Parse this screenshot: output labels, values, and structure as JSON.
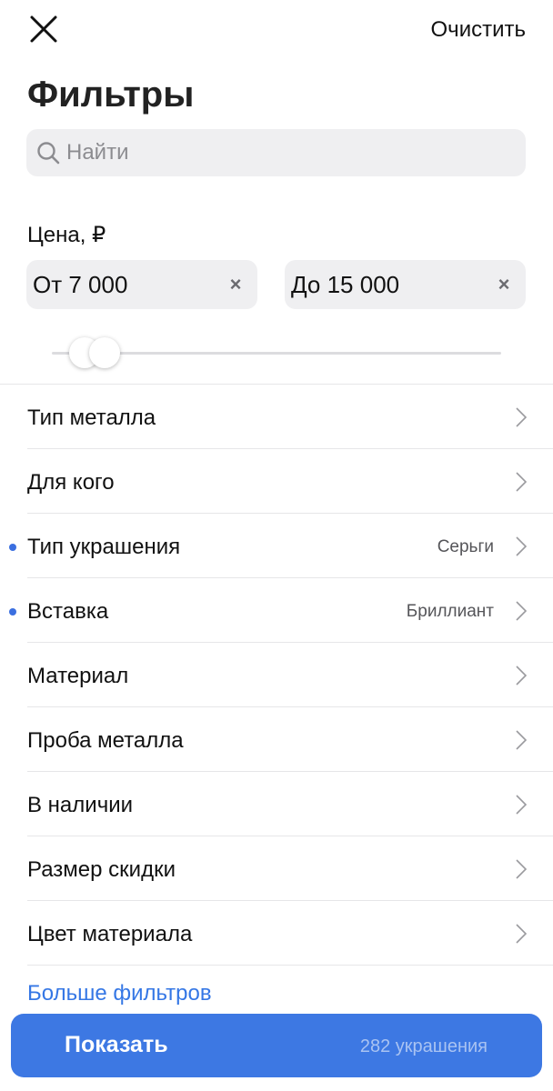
{
  "header": {
    "clear_label": "Очистить",
    "title": "Фильтры"
  },
  "search": {
    "placeholder": "Найти",
    "value": ""
  },
  "price": {
    "label": "Цена, ₽",
    "from": "От 7 000",
    "to": "До 15 000",
    "clear_symbol": "×",
    "slider_min_fraction": 0.07,
    "slider_max_fraction": 0.11
  },
  "filters": [
    {
      "label": "Тип металла",
      "selected": "",
      "active": false
    },
    {
      "label": "Для кого",
      "selected": "",
      "active": false
    },
    {
      "label": "Тип украшения",
      "selected": "Серьги",
      "active": true
    },
    {
      "label": "Вставка",
      "selected": "Бриллиант",
      "active": true
    },
    {
      "label": "Материал",
      "selected": "",
      "active": false
    },
    {
      "label": "Проба металла",
      "selected": "",
      "active": false
    },
    {
      "label": "В наличии",
      "selected": "",
      "active": false
    },
    {
      "label": "Размер скидки",
      "selected": "",
      "active": false
    },
    {
      "label": "Цвет материала",
      "selected": "",
      "active": false
    }
  ],
  "more_filters_label": "Больше фильтров",
  "show_button": {
    "label": "Показать",
    "count": "282 украшения"
  },
  "colors": {
    "accent": "#3d78e3",
    "link": "#3577e5",
    "active_dot": "#3b6fe0",
    "field_bg": "#efeff1"
  },
  "icons": {
    "close": "close-icon",
    "search": "search-icon",
    "chevron": "chevron-right-icon"
  }
}
